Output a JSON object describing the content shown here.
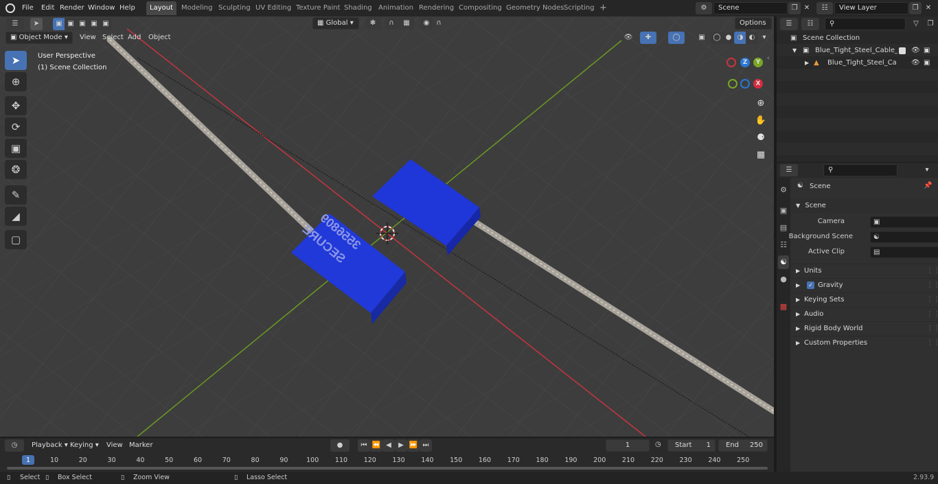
{
  "menubar": {
    "items": [
      "File",
      "Edit",
      "Render",
      "Window",
      "Help"
    ],
    "workspace_tabs": [
      "Layout",
      "Modeling",
      "Sculpting",
      "UV Editing",
      "Texture Paint",
      "Shading",
      "Animation",
      "Rendering",
      "Compositing",
      "Geometry Nodes",
      "Scripting"
    ],
    "active_tab": "Layout",
    "add_tab": "+",
    "scene_name": "Scene",
    "view_layer": "View Layer"
  },
  "header": {
    "mode": "Object Mode",
    "menus": [
      "View",
      "Select",
      "Add",
      "Object"
    ],
    "orientation": "Global",
    "options": "Options"
  },
  "viewport": {
    "perspective": "User Perspective",
    "collection": "(1) Scene Collection",
    "label_line1": "SECURE",
    "label_line2": "3556809",
    "colors": {
      "background": "#3d3d3d",
      "x_axis": "#c8343f",
      "y_axis": "#6a9a22",
      "seal": "#1f36d8",
      "cable": "#a8a39a",
      "accent": "#4772b3"
    }
  },
  "tools": [
    "tweak-select",
    "cursor",
    "move",
    "rotate",
    "scale",
    "transform",
    "annotate",
    "measure",
    "add-cube"
  ],
  "gizmo": {
    "z": "Z",
    "y": "Y",
    "x": "X"
  },
  "outliner": {
    "root": "Scene Collection",
    "items": [
      {
        "name": "Blue_Tight_Steel_Cable_Seal_",
        "level": 1
      },
      {
        "name": "Blue_Tight_Steel_Cable_S",
        "level": 2
      }
    ]
  },
  "properties": {
    "context": "Scene",
    "section": "Scene",
    "fields": [
      {
        "label": "Camera",
        "value": ""
      },
      {
        "label": "Background Scene",
        "value": ""
      },
      {
        "label": "Active Clip",
        "value": ""
      }
    ],
    "panels": [
      "Units",
      "Gravity",
      "Keying Sets",
      "Audio",
      "Rigid Body World",
      "Custom Properties"
    ],
    "gravity_checked": true
  },
  "timeline": {
    "menus": [
      "Playback",
      "Keying",
      "View",
      "Marker"
    ],
    "current_frame": "1",
    "start_label": "Start",
    "start": "1",
    "end_label": "End",
    "end": "250",
    "ticks": [
      "1",
      "10",
      "20",
      "30",
      "40",
      "50",
      "60",
      "70",
      "80",
      "90",
      "100",
      "110",
      "120",
      "130",
      "140",
      "150",
      "160",
      "170",
      "180",
      "190",
      "200",
      "210",
      "220",
      "230",
      "240",
      "250"
    ]
  },
  "statusbar": {
    "select": "Select",
    "box_select": "Box Select",
    "zoom_view": "Zoom View",
    "lasso_select": "Lasso Select",
    "version": "2.93.9"
  }
}
